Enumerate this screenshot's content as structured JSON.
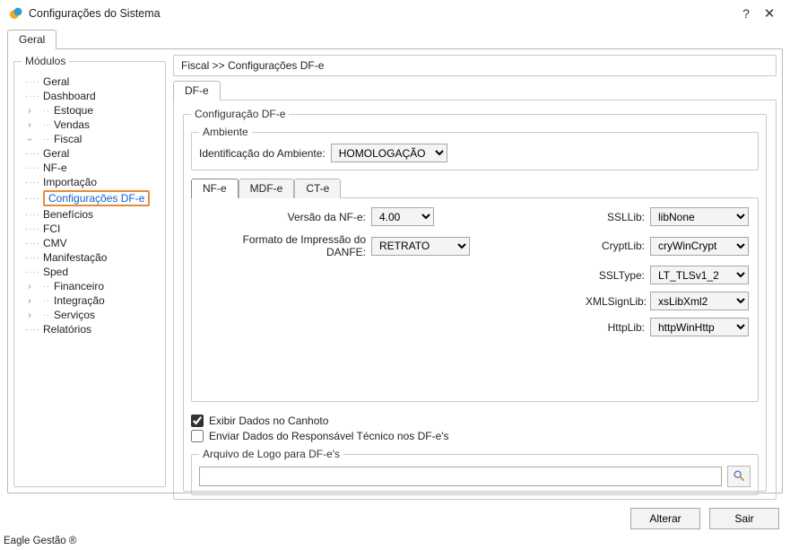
{
  "window": {
    "title": "Configurações do Sistema"
  },
  "outer_tab": "Geral",
  "modules_legend": "Módulos",
  "tree": {
    "geral": "Geral",
    "dashboard": "Dashboard",
    "estoque": "Estoque",
    "vendas": "Vendas",
    "fiscal": "Fiscal",
    "fiscal_children": {
      "geral": "Geral",
      "nfe": "NF-e",
      "importacao": "Importação",
      "config_dfe": "Configurações DF-e",
      "beneficios": "Benefícios",
      "fci": "FCI",
      "cmv": "CMV",
      "manifestacao": "Manifestação",
      "sped": "Sped"
    },
    "financeiro": "Financeiro",
    "integracao": "Integração",
    "servicos": "Serviços",
    "relatorios": "Relatórios"
  },
  "breadcrumb": "Fiscal >> Configurações DF-e",
  "inner_tab": "DF-e",
  "config_legend": "Configuração DF-e",
  "ambiente_legend": "Ambiente",
  "ambiente_label": "Identificação do Ambiente:",
  "ambiente_value": "HOMOLOGAÇÃO",
  "subtabs": {
    "nfe": "NF-e",
    "mdfe": "MDF-e",
    "cte": "CT-e"
  },
  "fields": {
    "versao_label": "Versão da NF-e:",
    "versao_value": "4.00",
    "danfe_label": "Formato de Impressão do DANFE:",
    "danfe_value": "RETRATO",
    "ssllib_label": "SSLLib:",
    "ssllib_value": "libNone",
    "cryptlib_label": "CryptLib:",
    "cryptlib_value": "cryWinCrypt",
    "ssltype_label": "SSLType:",
    "ssltype_value": "LT_TLSv1_2",
    "xmlsign_label": "XMLSignLib:",
    "xmlsign_value": "xsLibXml2",
    "httplib_label": "HttpLib:",
    "httplib_value": "httpWinHttp"
  },
  "check_canhoto": "Exibir Dados no Canhoto",
  "check_resp": "Enviar Dados do Responsável Técnico nos DF-e's",
  "logo_legend": "Arquivo de Logo para DF-e's",
  "buttons": {
    "alterar": "Alterar",
    "sair": "Sair"
  },
  "status": "Eagle Gestão ®"
}
